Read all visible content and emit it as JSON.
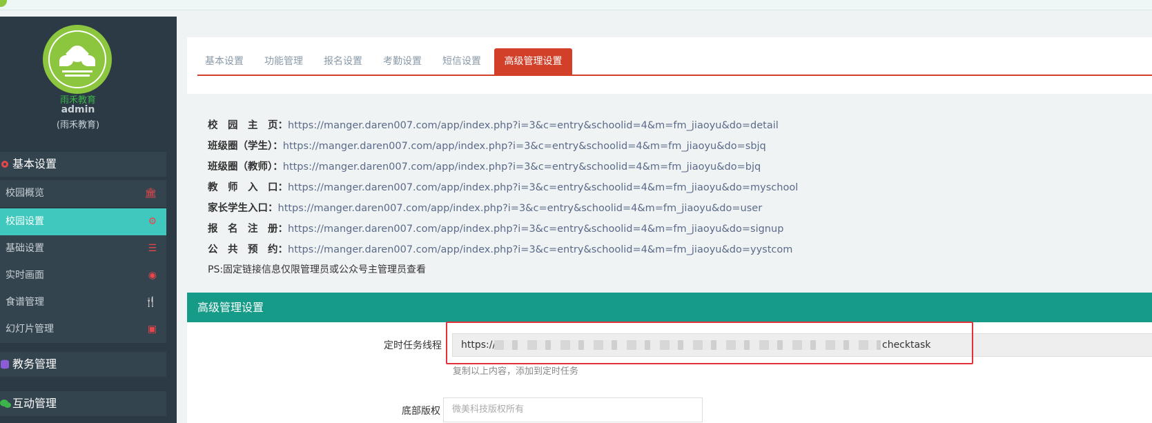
{
  "sidebar": {
    "brand_name": "雨禾教育",
    "username": "admin",
    "school": "(雨禾教育)",
    "sections": [
      {
        "label": "基本设置",
        "icon": "gear-icon",
        "color": "#e8464a"
      },
      {
        "label": "教务管理",
        "icon": "database-icon",
        "color": "#8a5cd6"
      },
      {
        "label": "互动管理",
        "icon": "chat-icon",
        "color": "#3cb44a"
      }
    ],
    "items": [
      {
        "label": "校园概览",
        "icon": "bank-icon"
      },
      {
        "label": "校园设置",
        "icon": "gear-icon",
        "active": true
      },
      {
        "label": "基础设置",
        "icon": "list-icon"
      },
      {
        "label": "实时画面",
        "icon": "eye-icon"
      },
      {
        "label": "食谱管理",
        "icon": "cutlery-icon"
      },
      {
        "label": "幻灯片管理",
        "icon": "image-icon"
      }
    ]
  },
  "tabs": [
    "基本设置",
    "功能管理",
    "报名设置",
    "考勤设置",
    "短信设置",
    "高级管理设置"
  ],
  "active_tab": "高级管理设置",
  "links": [
    {
      "key": "校　园　主　页：",
      "url": "https://manger.daren007.com/app/index.php?i=3&c=entry&schoolid=4&m=fm_jiaoyu&do=detail"
    },
    {
      "key": "班级圈（学生）：",
      "url": "https://manger.daren007.com/app/index.php?i=3&c=entry&schoolid=4&m=fm_jiaoyu&do=sbjq"
    },
    {
      "key": "班级圈（教师）：",
      "url": "https://manger.daren007.com/app/index.php?i=3&c=entry&schoolid=4&m=fm_jiaoyu&do=bjq"
    },
    {
      "key": "教　师　入　口：",
      "url": "https://manger.daren007.com/app/index.php?i=3&c=entry&schoolid=4&m=fm_jiaoyu&do=myschool"
    },
    {
      "key": "家长学生入口：",
      "url": "https://manger.daren007.com/app/index.php?i=3&c=entry&schoolid=4&m=fm_jiaoyu&do=user"
    },
    {
      "key": "报　名　注　册：",
      "url": "https://manger.daren007.com/app/index.php?i=3&c=entry&schoolid=4&m=fm_jiaoyu&do=signup"
    },
    {
      "key": "公　共　预　约：",
      "url": "https://manger.daren007.com/app/index.php?i=3&c=entry&schoolid=4&m=fm_jiaoyu&do=yystcom"
    }
  ],
  "ps_note": "PS:固定链接信息仅限管理员或公众号主管理员查看",
  "panel": {
    "title": "高级管理设置",
    "cron_label": "定时任务线程",
    "cron_value_start": "https://m",
    "cron_value_end": "checktask",
    "cron_hint": "复制以上内容，添加到定时任务",
    "copyright_label": "底部版权",
    "copyright_placeholder": "微美科技版权所有"
  },
  "colors": {
    "accent_red": "#d2402a",
    "teal": "#169b89",
    "active_item": "#3fc8bd",
    "sidebar_bg": "#2b3a44"
  }
}
